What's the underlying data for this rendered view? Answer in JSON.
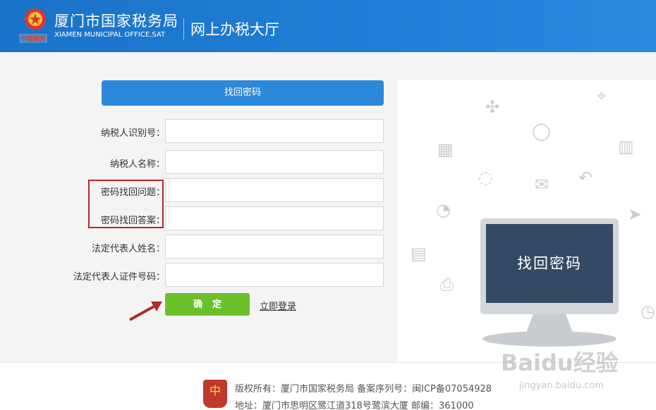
{
  "header": {
    "org_name": "厦门市国家税务局",
    "org_en": "XIAMEN MUNICIPAL OFFICE,SAT",
    "hall_name": "网上办税大厅",
    "emblem_sub": "中国税务"
  },
  "form": {
    "tab_label": "找回密码",
    "fields": [
      {
        "label": "纳税人识别号：",
        "value": ""
      },
      {
        "label": "纳税人名称：",
        "value": ""
      },
      {
        "label": "密码找回问题：",
        "value": ""
      },
      {
        "label": "密码找回答案：",
        "value": ""
      },
      {
        "label": "法定代表人姓名：",
        "value": ""
      },
      {
        "label": "法定代表人证件号码：",
        "value": ""
      }
    ],
    "submit_label": "确定",
    "login_link": "立即登录"
  },
  "illustration": {
    "screen_text": "找回密码"
  },
  "footer": {
    "line1": "版权所有：厦门市国家税务局 备案序列号：闽ICP备07054928",
    "line2": "地址：厦门市思明区鹭江道318号鹭滨大厦 邮编：361000",
    "badge": "中"
  },
  "watermark": {
    "text": "Baidu经验",
    "sub": "jingyan.baidu.com"
  },
  "colors": {
    "header_blue": "#1f7fd6",
    "submit_green": "#6cc12a",
    "highlight_red": "#b22a2a"
  }
}
